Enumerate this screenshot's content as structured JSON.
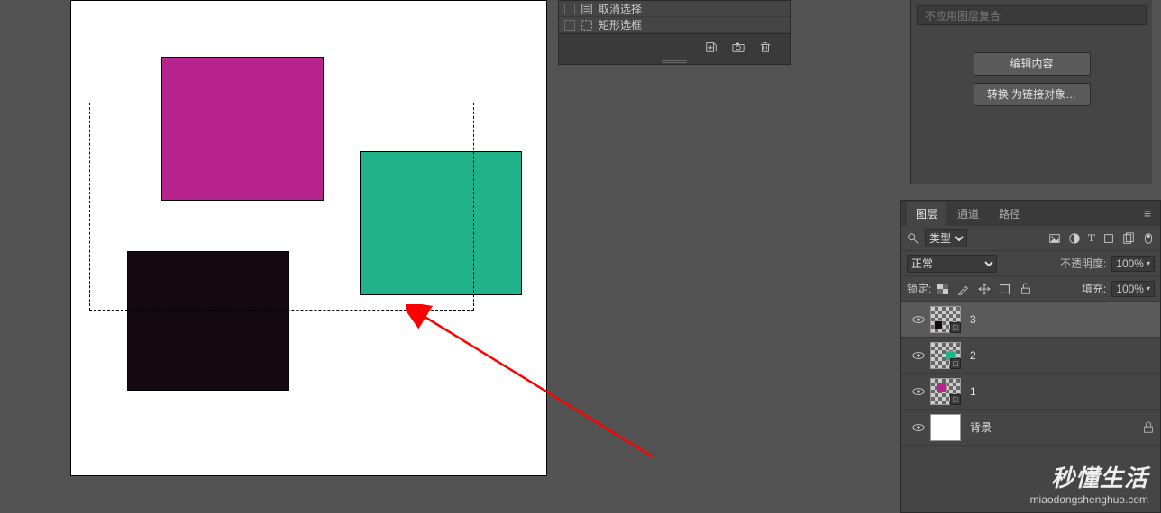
{
  "history": {
    "items": [
      {
        "icon": "deselect-icon",
        "label": "取消选择"
      },
      {
        "icon": "marquee-icon",
        "label": "矩形选框"
      }
    ]
  },
  "properties": {
    "blend_option": "不应用图层复合",
    "edit_button": "编辑内容",
    "convert_button": "转换 为链接对象…"
  },
  "layers_panel": {
    "tabs": {
      "layers": "图层",
      "channels": "通道",
      "paths": "路径"
    },
    "kind_search_label": "类型",
    "blend_mode": "正常",
    "opacity_label": "不透明度:",
    "opacity_value": "100%",
    "lock_label": "锁定:",
    "fill_label": "填充:",
    "fill_value": "100%",
    "layers": [
      {
        "name": "3",
        "selected": true,
        "visible": true,
        "thumb": "sel"
      },
      {
        "name": "2",
        "selected": false,
        "visible": true,
        "thumb": "teal"
      },
      {
        "name": "1",
        "selected": false,
        "visible": true,
        "thumb": "magenta"
      },
      {
        "name": "背景",
        "selected": false,
        "visible": true,
        "thumb": "white",
        "locked": true
      }
    ]
  },
  "watermark": {
    "title": "秒懂生活",
    "url": "miaodongshenghuo.com"
  }
}
